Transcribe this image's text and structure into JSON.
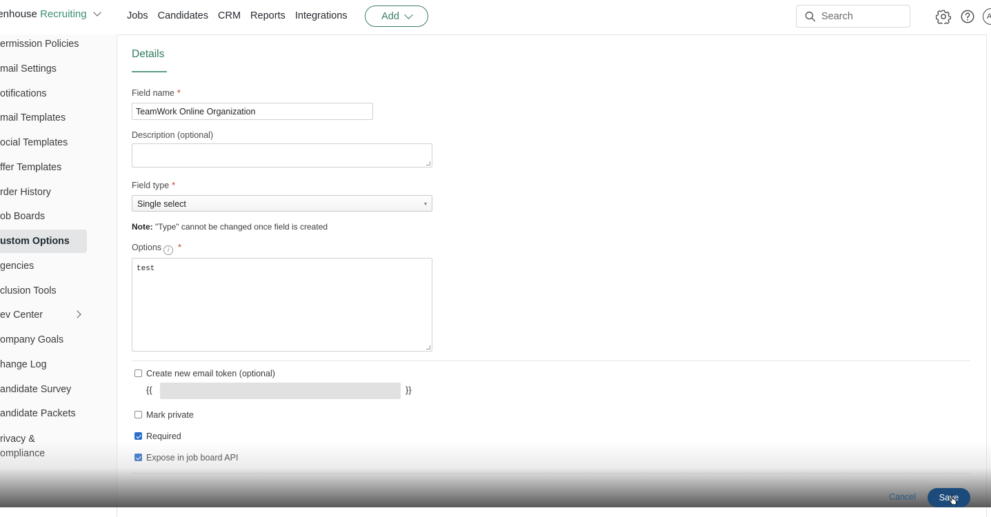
{
  "header": {
    "brand_part1": "eenhouse",
    "brand_part2": "Recruiting",
    "nav": [
      "Jobs",
      "Candidates",
      "CRM",
      "Reports",
      "Integrations"
    ],
    "add_label": "Add",
    "search_placeholder": "Search",
    "avatar_initials": "A"
  },
  "sidebar": {
    "items": [
      {
        "label": "ermission Policies"
      },
      {
        "label": "mail Settings"
      },
      {
        "label": "otifications"
      },
      {
        "label": "mail Templates"
      },
      {
        "label": "ocial Templates"
      },
      {
        "label": "ffer Templates"
      },
      {
        "label": "rder History"
      },
      {
        "label": "ob Boards"
      },
      {
        "label": "ustom Options"
      },
      {
        "label": "gencies"
      },
      {
        "label": "clusion Tools"
      },
      {
        "label": "ev Center"
      },
      {
        "label": "ompany Goals"
      },
      {
        "label": "hange Log"
      },
      {
        "label": "andidate Survey"
      },
      {
        "label": "andidate Packets"
      },
      {
        "label": "rivacy &"
      },
      {
        "label": "ompliance"
      }
    ]
  },
  "form": {
    "tab_label": "Details",
    "field_name_label": "Field name",
    "field_name_value": "TeamWork Online Organization",
    "description_label": "Description (optional)",
    "description_value": "",
    "field_type_label": "Field type",
    "field_type_value": "Single select",
    "note_bold": "Note:",
    "note_text": "\"Type\" cannot be changed once field is created",
    "options_label": "Options",
    "options_value": "test",
    "required_star": "*",
    "email_token_label": "Create new email token (optional)",
    "brace_open": "{{",
    "brace_close": "}}",
    "mark_private_label": "Mark private",
    "required_label": "Required",
    "expose_label": "Expose in job board API",
    "checkboxes": {
      "email_token": false,
      "mark_private": false,
      "required": true,
      "expose": true
    }
  },
  "footer": {
    "cancel_label": "Cancel",
    "save_label": "Save"
  }
}
